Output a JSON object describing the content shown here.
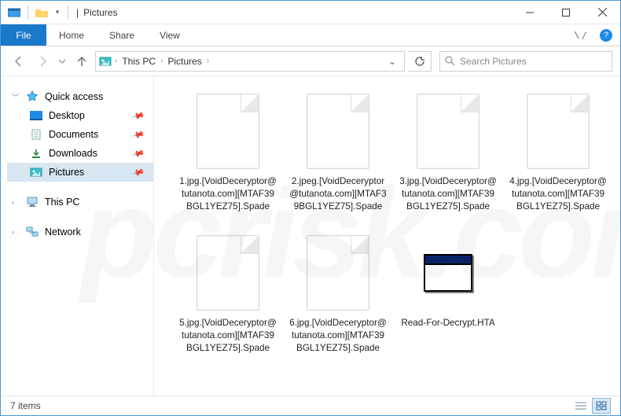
{
  "title": "Pictures",
  "titlebar_sep": "|",
  "ribbon": {
    "file": "File",
    "tabs": [
      "Home",
      "Share",
      "View"
    ]
  },
  "nav": {
    "breadcrumb": [
      "This PC",
      "Pictures"
    ],
    "search_placeholder": "Search Pictures"
  },
  "sidebar": {
    "quick_access": "Quick access",
    "pinned": [
      {
        "label": "Desktop",
        "icon": "desktop"
      },
      {
        "label": "Documents",
        "icon": "doc"
      },
      {
        "label": "Downloads",
        "icon": "down"
      },
      {
        "label": "Pictures",
        "icon": "pic",
        "selected": true
      }
    ],
    "this_pc": "This PC",
    "network": "Network"
  },
  "files": [
    {
      "name": "1.jpg.[VoidDeceryptor@tutanota.com][MTAF39BGL1YEZ75].Spade",
      "type": "blank"
    },
    {
      "name": "2.jpeg.[VoidDeceryptor@tutanota.com][MTAF39BGL1YEZ75].Spade",
      "type": "blank"
    },
    {
      "name": "3.jpg.[VoidDeceryptor@tutanota.com][MTAF39BGL1YEZ75].Spade",
      "type": "blank"
    },
    {
      "name": "4.jpg.[VoidDeceryptor@tutanota.com][MTAF39BGL1YEZ75].Spade",
      "type": "blank"
    },
    {
      "name": "5.jpg.[VoidDeceryptor@tutanota.com][MTAF39BGL1YEZ75].Spade",
      "type": "blank"
    },
    {
      "name": "6.jpg.[VoidDeceryptor@tutanota.com][MTAF39BGL1YEZ75].Spade",
      "type": "blank"
    },
    {
      "name": "Read-For-Decrypt.HTA",
      "type": "hta"
    }
  ],
  "status": {
    "count_text": "7 items"
  },
  "help_glyph": "?"
}
